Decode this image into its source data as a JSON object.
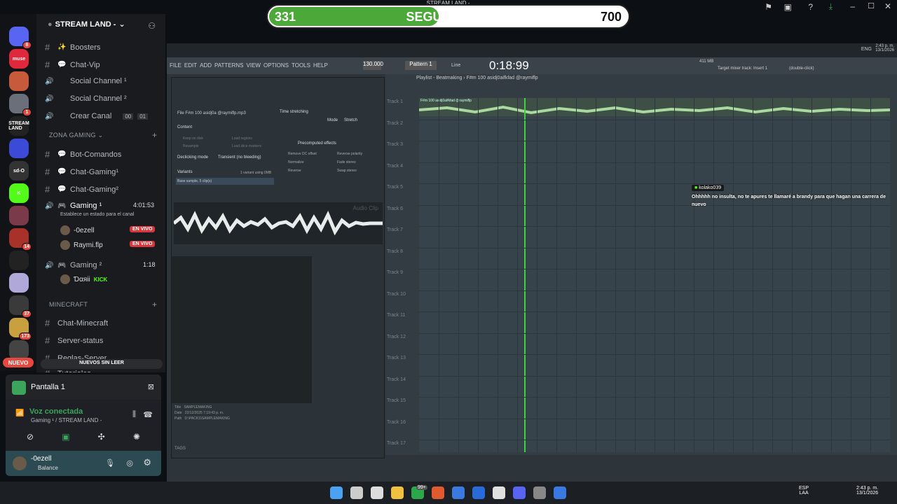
{
  "overlay": {
    "title": "STREAM LAND -",
    "followers_label": "SEGUIDORES",
    "followers_current": "331",
    "followers_goal": "700",
    "progress_fraction": 0.473,
    "progress_color": "#4da83a"
  },
  "servers": {
    "items": [
      {
        "name": "discord-home",
        "color": "#5865f2",
        "badge": "8"
      },
      {
        "name": "muse",
        "label": "muse",
        "color": "#e0283c"
      },
      {
        "name": "avatar-server",
        "color": "#c85a3c"
      },
      {
        "name": "gaming-server",
        "color": "#6a6f7a",
        "badge": "1"
      },
      {
        "name": "stream-land",
        "label": "STREAM LAND",
        "color": "#222"
      },
      {
        "name": "folder",
        "color": "#3b4bd8"
      },
      {
        "name": "sd-o",
        "label": "sd-O",
        "color": "#333"
      },
      {
        "name": "kick",
        "label": "K",
        "color": "#53fc18"
      },
      {
        "name": "anime-server",
        "color": "#7a3a4a"
      },
      {
        "name": "avengers",
        "color": "#a8322a",
        "badge": "14"
      },
      {
        "name": "disrespect",
        "color": "#222"
      },
      {
        "name": "anime2",
        "color": "#b0a8d8"
      },
      {
        "name": "dark-server",
        "color": "#3a3a3a",
        "badge": "37"
      },
      {
        "name": "gold-server",
        "color": "#c8a040",
        "badge": "173"
      },
      {
        "name": "misc",
        "color": "#444"
      }
    ],
    "new_label": "NUEVO"
  },
  "channels": {
    "server_name": "STREAM LAND -",
    "items": [
      {
        "type": "text",
        "icon": "✨",
        "label": "Boosters"
      },
      {
        "type": "text",
        "icon": "💬",
        "label": "Chat-Vip"
      },
      {
        "type": "voice",
        "label": "Social Channel ¹"
      },
      {
        "type": "voice",
        "label": "Social Channel ²"
      },
      {
        "type": "voice",
        "label": "Crear Canal",
        "count_a": "00",
        "count_b": "01"
      }
    ],
    "cat_gaming": "ZONA GAMING",
    "gaming_items": [
      {
        "label": "Bot-Comandos"
      },
      {
        "label": "Chat-Gaming¹"
      },
      {
        "label": "Chat-Gaming²"
      }
    ],
    "voice_gaming1": {
      "label": "Gaming ¹",
      "time": "4:01:53",
      "status": "Establece un estado para el canal"
    },
    "voice_users": [
      {
        "name": "-0ezell",
        "live": "EN VIVO"
      },
      {
        "name": "Raymi.flp",
        "live": "EN VIVO"
      }
    ],
    "voice_gaming2": {
      "label": "Gaming ²",
      "time": "1:18"
    },
    "voice_users2": [
      {
        "name": "Ɗαяii",
        "tag": "KICK"
      }
    ],
    "cat_minecraft": "MINECRAFT",
    "mc_items": [
      {
        "label": "Chat-Minecraft"
      },
      {
        "label": "Server-status"
      },
      {
        "label": "Reglas-Server"
      },
      {
        "label": "Tutoriales"
      }
    ],
    "unread": "NUEVOS SIN LEER"
  },
  "panel": {
    "screen_title": "Pantalla 1",
    "voice_status": "Voz conectada",
    "voice_sub": "Gaming ¹ / STREAM LAND -",
    "user_name": "-0ezell",
    "user_status": "Balance"
  },
  "fl": {
    "menu": [
      "FILE",
      "EDIT",
      "ADD",
      "PATTERNS",
      "VIEW",
      "OPTIONS",
      "TOOLS",
      "HELP"
    ],
    "tempo": "130.000",
    "pattern": "Pattern 1",
    "line": "Line",
    "time": "0:18:99",
    "mem": "411 MB",
    "hint": "Target mixer track: Insert 1",
    "hint2": "(double-click)",
    "playlist_title": "Playlist - Beatmaking › F#m 100 asidj0aifkfad @raymiflp",
    "sampler_file": "File  F#m 100 asidj0a @raymiflp.mp3",
    "sampler_labels": {
      "content": "Content",
      "keep": "Keep on disk",
      "resample": "Resample",
      "load_regions": "Load regions",
      "load_slice": "Load slice markers",
      "declicking": "Declicking mode",
      "transient": "Transient (no bleeding)",
      "variants": "Variants",
      "variant_info": "1 variant using 0MB",
      "base_sample": "Base sample, 5 clip(s)",
      "time_stretch": "Time stretching",
      "mode": "Mode",
      "stretch": "Stretch",
      "precomputed": "Precomputed effects",
      "remove_dc": "Remove DC offset",
      "reverse_pol": "Reverse polarity",
      "normalize": "Normalize",
      "fade_stereo": "Fade stereo",
      "reverse": "Reverse",
      "swap_stereo": "Swap stereo",
      "audio_clip": "Audio Clip",
      "title_label": "Title",
      "title_val": "SAMPLEMAKING",
      "date_label": "Date",
      "date_val": "22/12/2025 7:19:43 p. m.",
      "path_label": "Path",
      "path_val": "D:\\PACKS\\SAMPLEMAKING",
      "tags": "TAGS"
    },
    "tracks": [
      "Track 1",
      "Track 2",
      "Track 3",
      "Track 4",
      "Track 5",
      "Track 6",
      "Track 7",
      "Track 8",
      "Track 9",
      "Track 10",
      "Track 11",
      "Track 12",
      "Track 13",
      "Track 14",
      "Track 15",
      "Track 16",
      "Track 17"
    ],
    "clip_label": "F#m 100 asidj0aifkfad @raymiflp"
  },
  "chat": {
    "user": "kolako039",
    "message": "Ohhhhh no insulta, no te apures te llamaré a brandy para que hagan una carrera de nuevo"
  },
  "win": {
    "lang": "ESP",
    "lang2": "LAA",
    "time": "2:43 p. m.",
    "date": "13/1/2026",
    "badge": "99+",
    "fl_time": "2:43 p. m.",
    "fl_date": "13/1/2026",
    "fl_lang": "ENG"
  }
}
